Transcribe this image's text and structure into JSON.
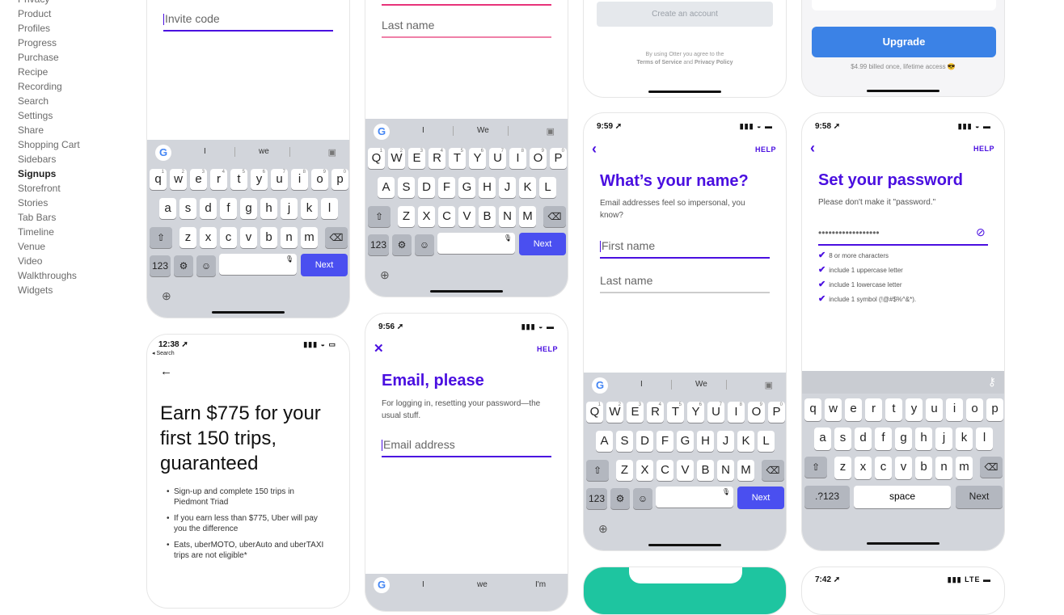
{
  "sidebar": {
    "items": [
      {
        "label": "Privacy"
      },
      {
        "label": "Product"
      },
      {
        "label": "Profiles"
      },
      {
        "label": "Progress"
      },
      {
        "label": "Purchase"
      },
      {
        "label": "Recipe"
      },
      {
        "label": "Recording"
      },
      {
        "label": "Search"
      },
      {
        "label": "Settings"
      },
      {
        "label": "Share"
      },
      {
        "label": "Shopping Cart"
      },
      {
        "label": "Sidebars"
      },
      {
        "label": "Signups",
        "active": true
      },
      {
        "label": "Storefront"
      },
      {
        "label": "Stories"
      },
      {
        "label": "Tab Bars"
      },
      {
        "label": "Timeline"
      },
      {
        "label": "Venue"
      },
      {
        "label": "Video"
      },
      {
        "label": "Walkthroughs"
      },
      {
        "label": "Widgets"
      }
    ]
  },
  "colors": {
    "accent": "#4a0fe0",
    "keyboard_bg": "#d2d5db",
    "next_key": "#4a4ff0",
    "upgrade": "#3b82e6",
    "pink": "#e8337a",
    "teal": "#1ec5a0"
  },
  "screens": {
    "invite": {
      "field_placeholder": "Invite code",
      "kb": {
        "sugg": [
          "I",
          "we"
        ],
        "rows": [
          [
            "q",
            "w",
            "e",
            "r",
            "t",
            "y",
            "u",
            "i",
            "o",
            "p"
          ],
          [
            "a",
            "s",
            "d",
            "f",
            "g",
            "h",
            "j",
            "k",
            "l"
          ],
          [
            "z",
            "x",
            "c",
            "v",
            "b",
            "n",
            "m"
          ]
        ],
        "sup": [
          "1",
          "2",
          "3",
          "4",
          "5",
          "6",
          "7",
          "8",
          "9",
          "0"
        ],
        "next": "Next",
        "num": "123"
      }
    },
    "lastname_top": {
      "field_placeholder": "Last name",
      "kb": {
        "sugg": [
          "I",
          "We"
        ],
        "rows": [
          [
            "Q",
            "W",
            "E",
            "R",
            "T",
            "Y",
            "U",
            "I",
            "O",
            "P"
          ],
          [
            "A",
            "S",
            "D",
            "F",
            "G",
            "H",
            "J",
            "K",
            "L"
          ],
          [
            "Z",
            "X",
            "C",
            "V",
            "B",
            "N",
            "M"
          ]
        ],
        "sup": [
          "1",
          "2",
          "3",
          "4",
          "5",
          "6",
          "7",
          "8",
          "9",
          "0"
        ],
        "next": "Next",
        "num": "123"
      }
    },
    "create_account": {
      "button": "Create an account",
      "legal_prefix": "By using Otter you agree to the",
      "terms": "Terms of Service",
      "and": "and",
      "privacy": "Privacy Policy"
    },
    "upgrade": {
      "button": "Upgrade",
      "price_note": "$4.99 billed once, lifetime access 😎"
    },
    "name": {
      "time": "9:59 ➚",
      "help": "HELP",
      "title": "What’s your name?",
      "subtitle": "Email addresses feel so impersonal, you know?",
      "first": "First name",
      "last": "Last name",
      "kb": {
        "sugg": [
          "I",
          "We"
        ],
        "rows": [
          [
            "Q",
            "W",
            "E",
            "R",
            "T",
            "Y",
            "U",
            "I",
            "O",
            "P"
          ],
          [
            "A",
            "S",
            "D",
            "F",
            "G",
            "H",
            "J",
            "K",
            "L"
          ],
          [
            "Z",
            "X",
            "C",
            "V",
            "B",
            "N",
            "M"
          ]
        ],
        "sup": [
          "1",
          "2",
          "3",
          "4",
          "5",
          "6",
          "7",
          "8",
          "9",
          "0"
        ],
        "next": "Next",
        "num": "123"
      }
    },
    "password": {
      "time": "9:58 ➚",
      "help": "HELP",
      "title": "Set your password",
      "subtitle": "Please don't make it \"password.\"",
      "dots": "••••••••••••••••••",
      "rules": [
        "8 or more characters",
        "include 1 uppercase letter",
        "include 1 lowercase letter",
        "include 1 symbol (!@#$%^&*)."
      ],
      "kb": {
        "rows": [
          [
            "q",
            "w",
            "e",
            "r",
            "t",
            "y",
            "u",
            "i",
            "o",
            "p"
          ],
          [
            "a",
            "s",
            "d",
            "f",
            "g",
            "h",
            "j",
            "k",
            "l"
          ],
          [
            "z",
            "x",
            "c",
            "v",
            "b",
            "n",
            "m"
          ]
        ],
        "num": ".?123",
        "space": "space",
        "next": "Next"
      }
    },
    "uber": {
      "time": "12:38 ➚",
      "back_app": "◂ Search",
      "title": "Earn $775 for your first 150 trips, guaranteed",
      "bullets": [
        "Sign-up and complete 150 trips in Piedmont Triad",
        "If you earn less than $775, Uber will pay you the difference",
        "Eats, uberMOTO, uberAuto and uberTAXI trips are not eligible*"
      ]
    },
    "email": {
      "time": "9:56 ➚",
      "help": "HELP",
      "title": "Email, please",
      "subtitle": "For logging in, resetting your password—the usual stuff.",
      "field": "Email address",
      "kb_sugg": [
        "I",
        "we",
        "I'm"
      ]
    },
    "bottom_right": {
      "time": "7:42 ➚",
      "carrier": "LTE"
    }
  }
}
